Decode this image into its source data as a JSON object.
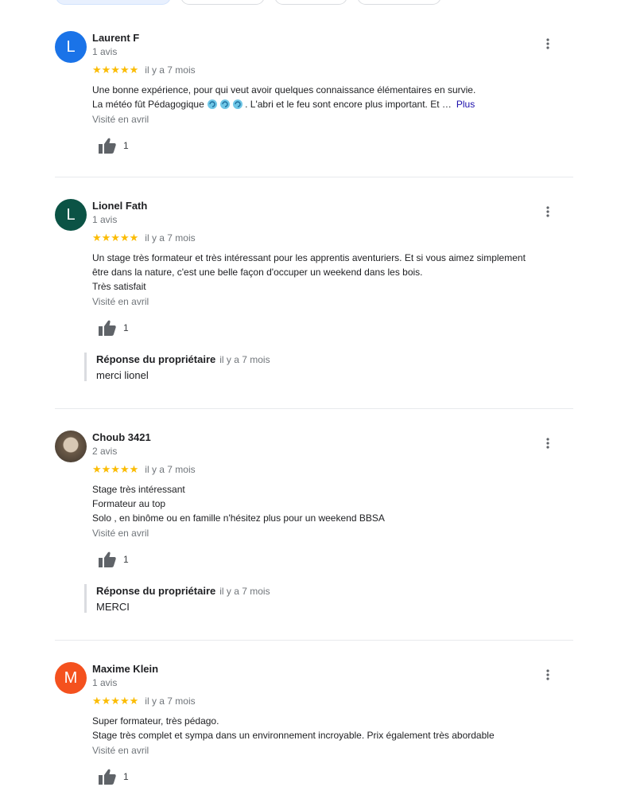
{
  "reviews": [
    {
      "initial": "L",
      "avatar_color": "#1a73e8",
      "name": "Laurent F",
      "count": "1 avis",
      "stars": "★★★★★",
      "time": "il y a 7 mois",
      "lines": [
        "Une bonne expérience, pour qui veut avoir quelques connaissance élémentaires en survie."
      ],
      "line2_a": "La météo  fût Pédagogique ",
      "line2_b": ". L'abri et le feu sont encore plus important. Et …",
      "more_label": "Plus",
      "visited": "Visité en avril",
      "likes": "1"
    },
    {
      "initial": "L",
      "avatar_color": "#0b5345",
      "name": "Lionel Fath",
      "count": "1 avis",
      "stars": "★★★★★",
      "time": "il y a 7 mois",
      "lines": [
        "Un stage très formateur et très intéressant pour les apprentis aventuriers. Et si vous aimez simplement",
        "être dans la nature, c'est une belle façon d'occuper un weekend dans les bois.",
        "Très satisfait"
      ],
      "visited": "Visité en avril",
      "likes": "1",
      "reply": {
        "owner": "Réponse du propriétaire",
        "time": "il y a 7 mois",
        "text": "merci lionel"
      }
    },
    {
      "name": "Choub 3421",
      "count": "2 avis",
      "stars": "★★★★★",
      "time": "il y a 7 mois",
      "lines": [
        "Stage très intéressant",
        "Formateur au top",
        "Solo , en binôme ou en famille n'hésitez plus pour un weekend BBSA"
      ],
      "visited": "Visité en avril",
      "likes": "1",
      "reply": {
        "owner": "Réponse du propriétaire",
        "time": "il y a 7 mois",
        "text": "MERCI"
      }
    },
    {
      "initial": "M",
      "avatar_color": "#f4511e",
      "name": "Maxime Klein",
      "count": "1 avis",
      "stars": "★★★★★",
      "time": "il y a 7 mois",
      "lines": [
        "Super formateur, très pédago.",
        "Stage très complet et sympa dans un environnement incroyable. Prix également très abordable"
      ],
      "visited": "Visité en avril",
      "likes": "1"
    }
  ],
  "colors": {
    "star": "#fbbc04",
    "link": "#1a0dab",
    "muted": "#70757a"
  }
}
